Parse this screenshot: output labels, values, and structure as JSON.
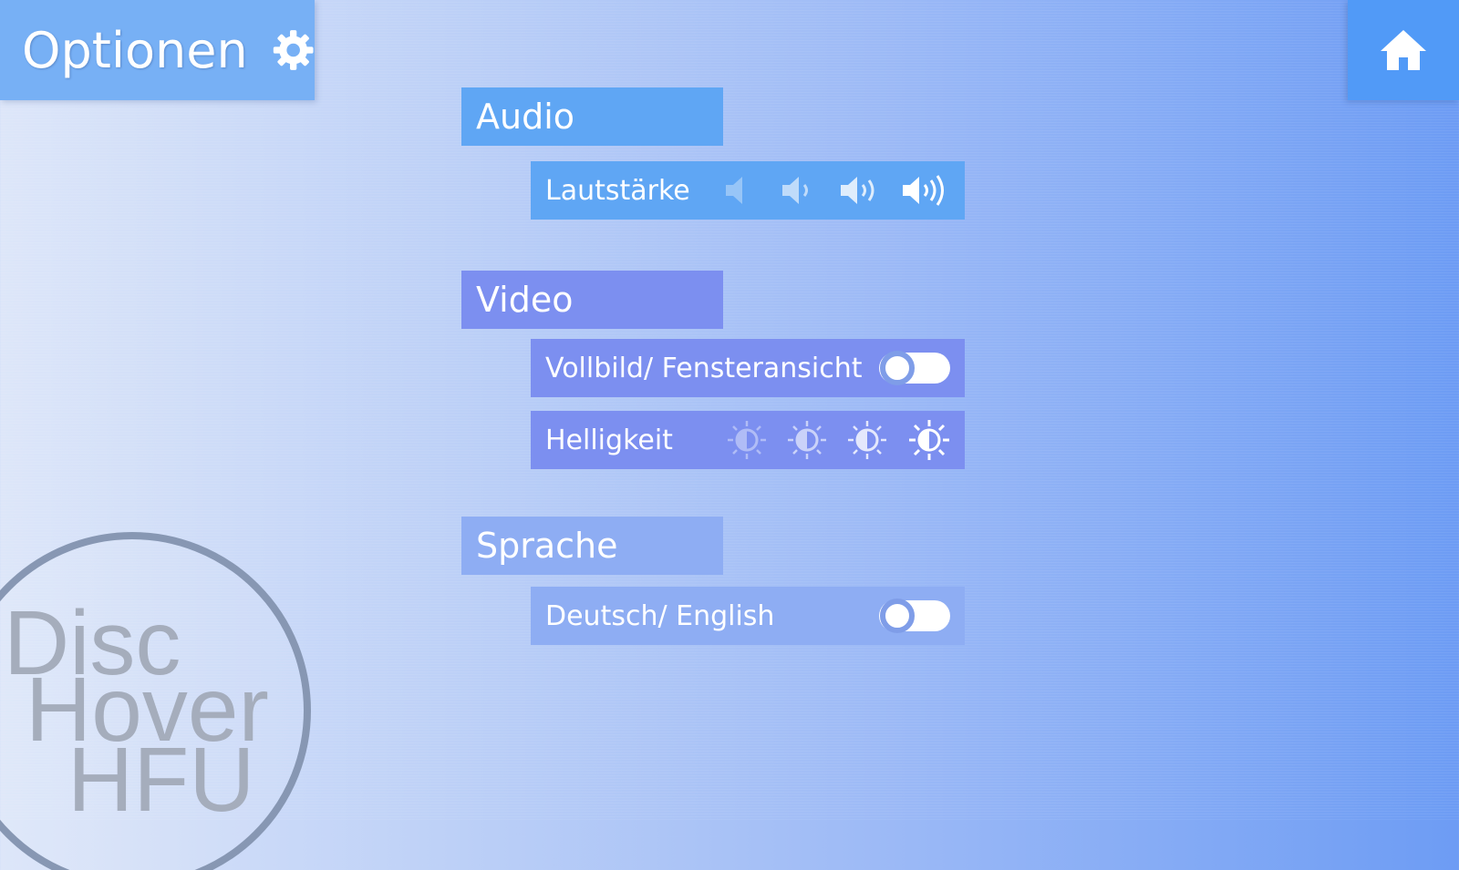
{
  "colors": {
    "audio": "#5fa6f4",
    "video": "#7c8ff0",
    "language": "#8eadf3",
    "title_bar": "#77b0f5",
    "home_button": "#519af7"
  },
  "header": {
    "title": "Optionen",
    "settings_icon": "gear-icon",
    "home_icon": "home-icon"
  },
  "audio": {
    "title": "Audio",
    "volume": {
      "label": "Lautstärke",
      "levels": [
        "speaker-mute-icon",
        "speaker-low-icon",
        "speaker-medium-icon",
        "speaker-high-icon"
      ],
      "selected_level": 4
    }
  },
  "video": {
    "title": "Video",
    "fullscreen": {
      "label": "Vollbild/ Fensteransicht",
      "toggle_on": false
    },
    "brightness": {
      "label": "Helligkeit",
      "levels": [
        "brightness-1-icon",
        "brightness-2-icon",
        "brightness-3-icon",
        "brightness-4-icon"
      ],
      "selected_level": 4
    }
  },
  "language": {
    "title": "Sprache",
    "toggle": {
      "label": "Deutsch/ English",
      "toggle_on": false
    }
  },
  "logo": {
    "line1": "Disc",
    "line2": "Hover",
    "line3": "HFU"
  }
}
